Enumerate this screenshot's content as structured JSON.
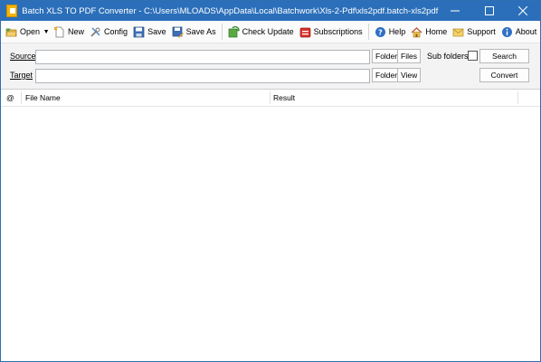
{
  "window": {
    "title": "Batch XLS TO PDF Converter - C:\\Users\\MLOADS\\AppData\\Local\\Batchwork\\Xls-2-Pdf\\xls2pdf.batch-xls2pdf"
  },
  "toolbar": {
    "open": "Open",
    "new": "New",
    "config": "Config",
    "save": "Save",
    "save_as": "Save As",
    "check_update": "Check Update",
    "subscriptions": "Subscriptions",
    "help": "Help",
    "home": "Home",
    "support": "Support",
    "about": "About"
  },
  "form": {
    "source_label": "Source",
    "target_label": "Target",
    "source_value": "",
    "target_value": "",
    "folder_btn": "Folder",
    "files_btn": "Files",
    "view_btn": "View",
    "sub_folders_label": "Sub folders",
    "sub_folders_checked": false,
    "search_btn": "Search",
    "convert_btn": "Convert"
  },
  "list": {
    "columns": [
      "@",
      "File Name",
      "Result"
    ],
    "rows": []
  },
  "colors": {
    "titlebar": "#2b6fba",
    "form_bg": "#f3f3f3"
  }
}
